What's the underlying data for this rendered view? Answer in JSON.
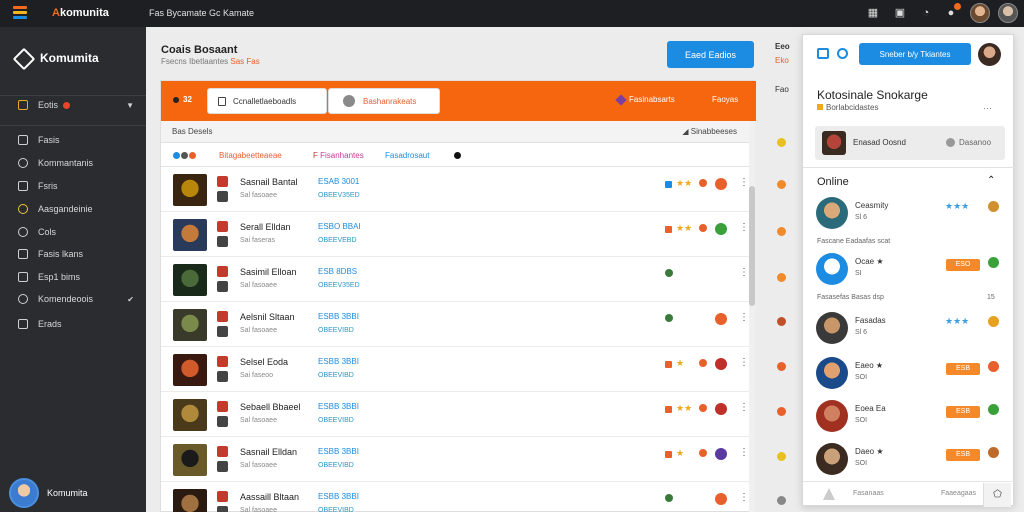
{
  "topbar": {
    "brand": "Akomunita",
    "page_title": "Fas Bycamate Gc Kamate",
    "icons": [
      "grid-icon",
      "calendar-icon",
      "bell-icon",
      "notification-icon"
    ]
  },
  "sidebar": {
    "brand": "Komumita",
    "items": [
      {
        "label": "Eotis",
        "icon": "folder-icon"
      },
      {
        "label": "Fasis",
        "icon": "chat-icon"
      },
      {
        "label": "Kommantanis",
        "icon": "comment-icon"
      },
      {
        "label": "Fsris",
        "icon": "monitor-icon"
      },
      {
        "label": "Aasgandeinie",
        "icon": "globe-icon"
      },
      {
        "label": "Cols",
        "icon": "people-icon"
      },
      {
        "label": "Fasis lkans",
        "icon": "tag-icon"
      },
      {
        "label": "Esp1 bims",
        "icon": "image-icon"
      },
      {
        "label": "Komendeoois",
        "icon": "settings-icon"
      },
      {
        "label": "Erads",
        "icon": "list-icon"
      }
    ],
    "user_name": "Komumita"
  },
  "main": {
    "title": "Coais Bosaant",
    "subtitle_prefix": "Fsecns Ibetlaantes",
    "subtitle_highlight": "Sas Fas",
    "cta_label": "Eaed Eadios"
  },
  "filterbar": {
    "count": "32",
    "input_value": "Ccnalletlaeboadls",
    "select_value": "Bashanrakeats",
    "right_label": "Fasinabsarts",
    "right_action": "Faoyas"
  },
  "table": {
    "header_left": "Bas Desels",
    "header_right": "Sinabbeeses",
    "tags": [
      "Bitagabeetteaeae",
      "Fisanhantes",
      "Fasadrosaut"
    ],
    "rows": [
      {
        "name": "Sasnail Bantal",
        "sub": "Sal fasoaee",
        "code": "ESAB 3001",
        "code2": "OBEEV35ED",
        "stars": "★★",
        "status": "orange"
      },
      {
        "name": "Serall Elldan",
        "sub": "Sai faseras",
        "code": "ESBO BBAI",
        "code2": "OBEEVEBD",
        "stars": "★★",
        "status": "green"
      },
      {
        "name": "Sasimil Elloan",
        "sub": "Sal fasoaee",
        "code": "ESB 8DBS",
        "code2": "OBEEV35ED",
        "stars": "",
        "status": "orange"
      },
      {
        "name": "Aelsnil Sltaan",
        "sub": "Sal fasoaee",
        "code": "ESBB 3BBI",
        "code2": "OBEEVIBD",
        "stars": "",
        "status": "orange"
      },
      {
        "name": "Selsel Eoda",
        "sub": "Sai faseoo",
        "code": "ESBB 3BBI",
        "code2": "OBEEVIBD",
        "stars": "★",
        "status": "red"
      },
      {
        "name": "Sebaell Bbaeel",
        "sub": "Sal fasoaee",
        "code": "ESBB 3BBI",
        "code2": "OBEEVIBD",
        "stars": "★★",
        "status": "red"
      },
      {
        "name": "Sasnail Elldan",
        "sub": "Sal fasoaee",
        "code": "ESBB 3BBI",
        "code2": "OBEEVIBD",
        "stars": "★",
        "status": "purple"
      },
      {
        "name": "Aassaill Bltaan",
        "sub": "Sal fasoaee",
        "code": "ESBB 3BBI",
        "code2": "OBEEVIBD",
        "stars": "",
        "status": "orange"
      }
    ]
  },
  "midcol": {
    "t1": "Eeo",
    "t2": "Eko",
    "t3": "Fao"
  },
  "right_panel": {
    "button_label": "Sneber b/y  Tkiantes",
    "title": "Kotosinale Snokarge",
    "subtitle": "Borlabcidastes",
    "card_name": "Enasad Oosnd",
    "card_action": "Dasanoo",
    "online_label": "Online",
    "friends": [
      {
        "name": "Ceasmity",
        "sub": "Sl 6",
        "stars": "★★★",
        "badge": ""
      },
      {
        "name": "Ocae ★",
        "sub": "SI",
        "stars": "",
        "badge": "ESO"
      },
      {
        "name": "Fasadas",
        "sub": "Sl 6",
        "stars": "★★★",
        "badge": ""
      },
      {
        "name": "Eaeo ★",
        "sub": "SOI",
        "stars": "",
        "badge": "ESB"
      },
      {
        "name": "Eoea Ea",
        "sub": "SOI",
        "stars": "",
        "badge": "ESB"
      },
      {
        "name": "Daeo ★",
        "sub": "SOI",
        "stars": "",
        "badge": "ESB"
      }
    ],
    "sep1": "Fascane  Eadaafas scat",
    "sep2": "Fasasefas Basas dsp",
    "sep2_right": "15",
    "bottom_left": "Fasanaas",
    "bottom_right": "Faaeagaas"
  },
  "colors": {
    "accent_orange": "#f5660f",
    "accent_blue": "#1c8ce2",
    "sidebar_bg": "#2b2c30",
    "topbar_bg": "#1e1f22"
  }
}
